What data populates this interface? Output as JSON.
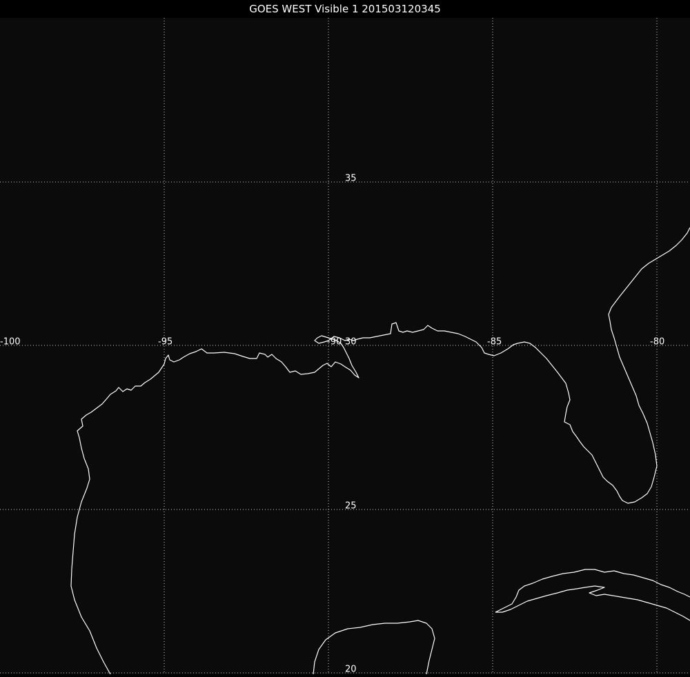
{
  "title": "GOES WEST Visible 1 201503120345",
  "lon_labels": [
    "-100",
    "-95",
    "-90",
    "-85",
    "-80"
  ],
  "lat_labels": [
    "35",
    "30",
    "25",
    "20"
  ],
  "colors": {
    "background": "#0b0b0b",
    "coastline": "#ffffff",
    "grid": "#cfcfcf"
  }
}
